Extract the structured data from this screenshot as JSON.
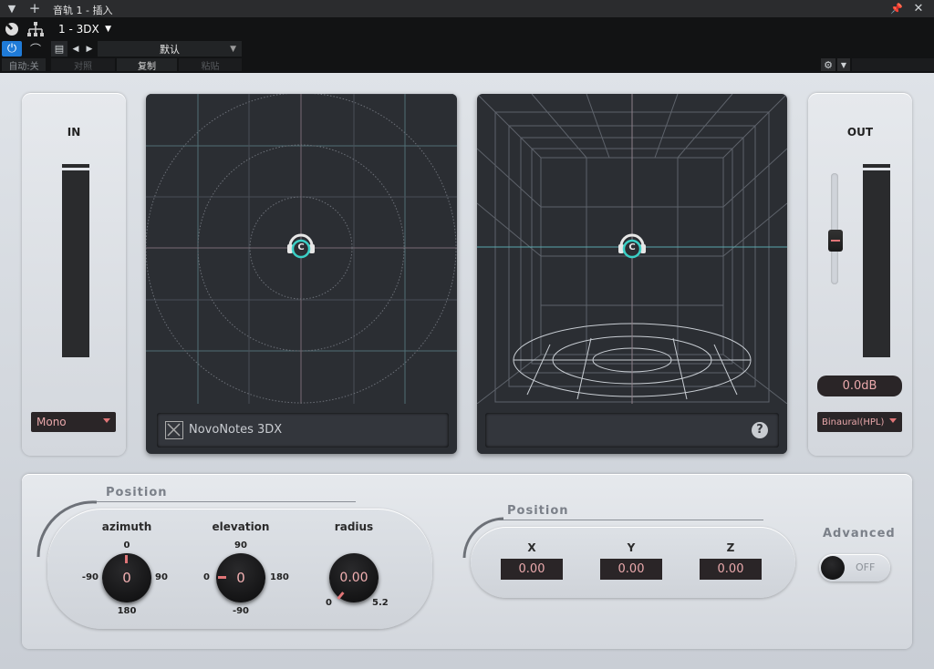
{
  "titlebar": {
    "title": "音轨 1 - 插入"
  },
  "host": {
    "preset_slot": "1 - 3DX",
    "preset_name": "默认",
    "auto_label": "自动:关",
    "compare_label": "对照",
    "copy_label": "复制",
    "paste_label": "粘贴"
  },
  "input": {
    "label": "IN",
    "mode": "Mono"
  },
  "output": {
    "label": "OUT",
    "gain_display": "0.0dB",
    "mode": "Binaural(HPL)",
    "level": 0
  },
  "views": {
    "brand": "NovoNotes 3DX",
    "listener_label": "C",
    "help_label": "?"
  },
  "polar": {
    "title": "Position",
    "azimuth": {
      "label": "azimuth",
      "value": "0",
      "top": "0",
      "left": "-90",
      "right": "90",
      "bottom": "180"
    },
    "elevation": {
      "label": "elevation",
      "value": "0",
      "top": "90",
      "left": "0",
      "right": "180",
      "bottom": "-90"
    },
    "radius": {
      "label": "radius",
      "value": "0.00",
      "min": "0",
      "max": "5.2"
    }
  },
  "cartesian": {
    "title": "Position",
    "x": {
      "label": "X",
      "value": "0.00"
    },
    "y": {
      "label": "Y",
      "value": "0.00"
    },
    "z": {
      "label": "Z",
      "value": "0.00"
    }
  },
  "advanced": {
    "label": "Advanced",
    "state": "OFF"
  }
}
